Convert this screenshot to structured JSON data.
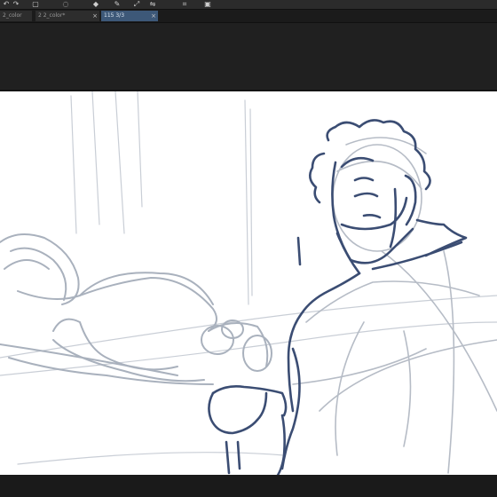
{
  "toolbar": {
    "tools": [
      {
        "icon": "undo-icon",
        "glyph": "↶"
      },
      {
        "icon": "redo-icon",
        "glyph": "↷"
      },
      {
        "icon": "selection-icon",
        "glyph": "▢"
      },
      {
        "icon": "lasso-icon",
        "glyph": "◌"
      },
      {
        "icon": "fill-icon",
        "glyph": "◆"
      },
      {
        "icon": "eyedropper-icon",
        "glyph": "✎"
      },
      {
        "icon": "transform-icon",
        "glyph": "⤢"
      },
      {
        "icon": "flip-icon",
        "glyph": "⇋"
      },
      {
        "icon": "crop-icon",
        "glyph": "⌗"
      },
      {
        "icon": "view-icon",
        "glyph": "▣"
      }
    ]
  },
  "tabs": [
    {
      "label": "2_color"
    },
    {
      "label": "2 2_color*"
    },
    {
      "label": "115 3/3"
    }
  ],
  "colors": {
    "sketch_gray": "#a9b1bd",
    "sketch_blue": "#3b4d73",
    "tab_active": "#3d5878"
  }
}
